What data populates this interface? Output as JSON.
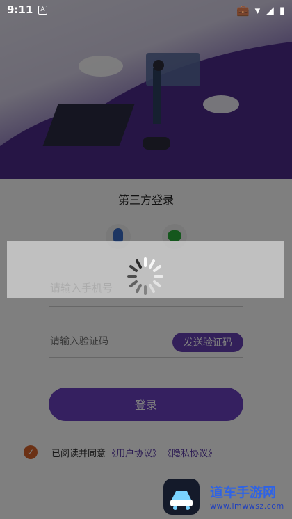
{
  "status_bar": {
    "time": "9:11"
  },
  "login": {
    "third_party_title": "第三方登录",
    "phone_placeholder": "请输入手机号",
    "code_placeholder": "请输入验证码",
    "send_code_label": "发送验证码",
    "login_label": "登录"
  },
  "agreement": {
    "prefix": "已阅读并同意",
    "user_agreement": "《用户协议》",
    "privacy_agreement": "《隐私协议》"
  },
  "watermark": {
    "brand": "道车手游网",
    "url": "www.lmwwsz.com"
  },
  "colors": {
    "accent": "#6a41c0",
    "checkbox": "#d6622b",
    "hero_purple": "#4b2d86"
  },
  "icons": [
    "qq-icon",
    "wechat-icon",
    "loading-spinner-icon",
    "checkmark-icon"
  ]
}
